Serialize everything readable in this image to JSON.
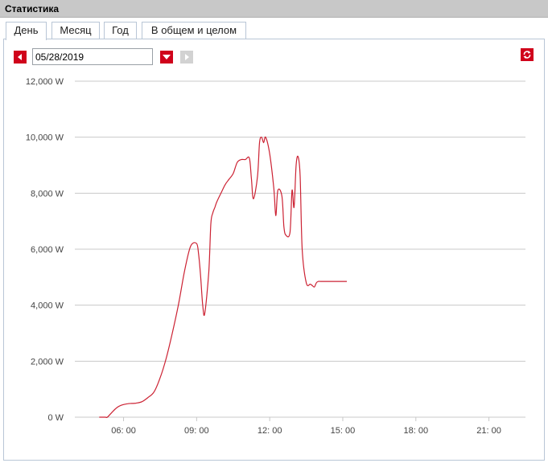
{
  "window": {
    "title": "Статистика"
  },
  "tabs": [
    {
      "label": "День",
      "active": true
    },
    {
      "label": "Месяц",
      "active": false
    },
    {
      "label": "Год",
      "active": false
    },
    {
      "label": "В общем и целом",
      "active": false
    }
  ],
  "date_picker": {
    "value": "05/28/2019"
  },
  "icons": {
    "prev": "arrow-left-icon",
    "calendar": "chevron-down-icon",
    "next": "arrow-right-icon",
    "refresh": "refresh-icon"
  },
  "colors": {
    "accent": "#d0021b",
    "line": "#cc2233",
    "grid": "#c8c8c8"
  },
  "chart_data": {
    "type": "line",
    "title": "",
    "xlabel": "",
    "ylabel": "",
    "ylim": [
      0,
      12000
    ],
    "xlim": [
      "04:00",
      "22:30"
    ],
    "y_ticks": [
      "0 W",
      "2,000 W",
      "4,000 W",
      "6,000 W",
      "8,000 W",
      "10,000 W",
      "12,000 W"
    ],
    "x_ticks": [
      "06: 00",
      "09: 00",
      "12: 00",
      "15: 00",
      "18: 00",
      "21: 00"
    ],
    "grid": true,
    "series": [
      {
        "values_x": [
          "05:00",
          "05:15",
          "05:20",
          "05:30",
          "05:40",
          "05:50",
          "06:00",
          "06:10",
          "06:20",
          "06:30",
          "06:45",
          "07:00",
          "07:15",
          "07:30",
          "07:45",
          "08:00",
          "08:15",
          "08:30",
          "08:45",
          "09:00",
          "09:05",
          "09:10",
          "09:15",
          "09:20",
          "09:30",
          "09:35",
          "09:40",
          "09:45",
          "09:50",
          "10:00",
          "10:10",
          "10:20",
          "10:30",
          "10:40",
          "10:50",
          "11:00",
          "11:10",
          "11:15",
          "11:20",
          "11:30",
          "11:35",
          "11:40",
          "11:45",
          "11:50",
          "12:00",
          "12:10",
          "12:15",
          "12:20",
          "12:30",
          "12:35",
          "12:40",
          "12:50",
          "12:55",
          "13:00",
          "13:05",
          "13:10",
          "13:15",
          "13:20",
          "13:30",
          "13:40",
          "13:45",
          "13:50",
          "13:55",
          "14:00",
          "14:05",
          "14:10",
          "14:15",
          "14:20",
          "14:25",
          "14:30",
          "14:35",
          "14:40",
          "14:45",
          "14:50",
          "15:00",
          "15:05",
          "15:10"
        ],
        "values_y": [
          0,
          0,
          0,
          150,
          300,
          400,
          450,
          480,
          490,
          500,
          550,
          700,
          900,
          1400,
          2100,
          3000,
          4000,
          5200,
          6100,
          6200,
          5800,
          5000,
          4000,
          3700,
          5200,
          6900,
          7300,
          7500,
          7700,
          8000,
          8300,
          8500,
          8700,
          9100,
          9200,
          9200,
          9250,
          8500,
          7800,
          8600,
          9800,
          10000,
          9800,
          10000,
          9400,
          8200,
          7200,
          8100,
          7900,
          6800,
          6500,
          6600,
          8100,
          7500,
          9000,
          9300,
          8600,
          6000,
          4800,
          4750,
          4700,
          4650,
          4800,
          4850,
          4850,
          4850,
          4850,
          4850,
          4850,
          4850,
          4850,
          4850,
          4850,
          4850,
          4850,
          4850,
          4850
        ]
      }
    ]
  }
}
